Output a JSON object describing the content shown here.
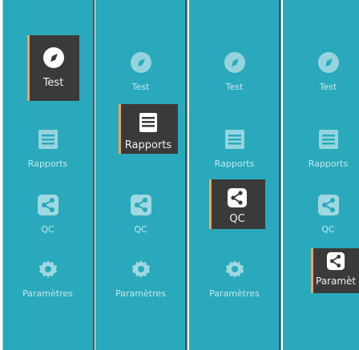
{
  "nav": {
    "items": [
      {
        "label": "Test",
        "icon": "compass-icon"
      },
      {
        "label": "Rapports",
        "icon": "list-icon"
      },
      {
        "label": "QC",
        "icon": "share-icon"
      },
      {
        "label": "Paramètres",
        "icon": "gear-icon"
      }
    ]
  },
  "panels": [
    {
      "active_label": "Test",
      "active_icon": "compass-icon"
    },
    {
      "active_label": "Rapports",
      "active_icon": "list-icon"
    },
    {
      "active_label": "QC",
      "active_icon": "share-icon"
    },
    {
      "active_label": "Paramèt",
      "active_icon": "share-icon"
    }
  ],
  "colors": {
    "sidebar_bg": "#2aa9bc",
    "active_bg": "#3a3a3a",
    "accent": "#f0a35a"
  }
}
